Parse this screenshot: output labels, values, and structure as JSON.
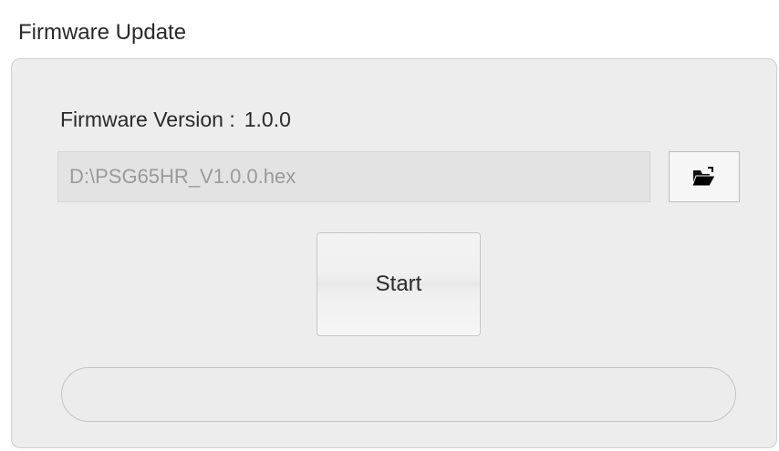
{
  "window": {
    "title": "Firmware Update"
  },
  "firmware": {
    "version_label": "Firmware Version :",
    "version_value": "1.0.0",
    "file_path": "D:\\PSG65HR_V1.0.0.hex"
  },
  "actions": {
    "browse_icon": "folder-open-icon",
    "start_label": "Start"
  },
  "progress": {
    "fraction": 0
  },
  "colors": {
    "panel_background": "#ededed",
    "field_text": "#9a9a9a",
    "progress_fill": "#3a9ad9"
  }
}
